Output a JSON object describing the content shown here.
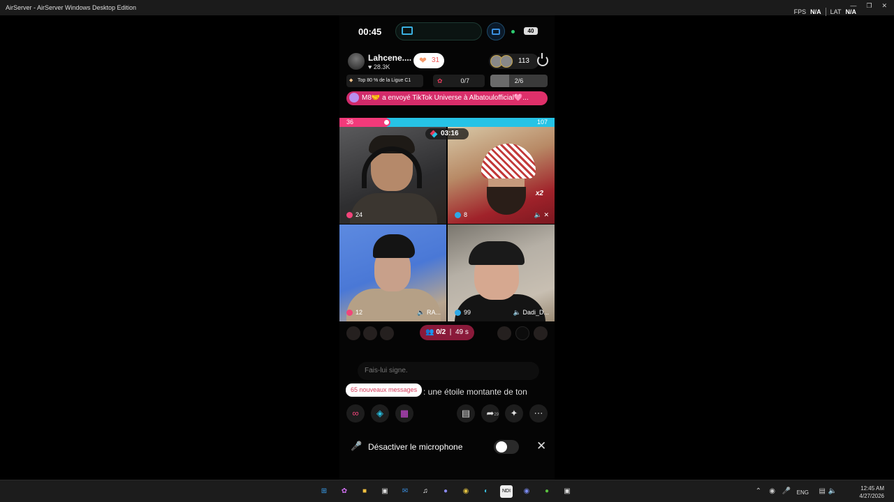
{
  "window": {
    "title": "AirServer - AirServer Windows Desktop Edition",
    "fps_label": "FPS",
    "fps_value": "N/A",
    "lat_label": "LAT",
    "lat_value": "N/A"
  },
  "status_bar": {
    "time": "00:45",
    "battery": "40"
  },
  "host": {
    "name": "Lahcene....",
    "likes": "28.3K",
    "hearts": "31",
    "viewer_count": "113"
  },
  "stats": {
    "league": "Top 80 % de la Ligue C1",
    "roses": "0/7",
    "progress_text": "2/6",
    "progress_fraction": 0.33
  },
  "banner": "M8🤝 a envoyé TikTok Universe à Albatoulofficial🩷...",
  "battle": {
    "left_score": "36",
    "right_score": "107",
    "left_fraction": 0.22,
    "timer": "03:16"
  },
  "participants": [
    {
      "score": "24",
      "team": "pink",
      "name": ""
    },
    {
      "score": "8",
      "team": "blue",
      "name": "",
      "multiplier": "x2"
    },
    {
      "score": "12",
      "team": "pink",
      "name": "RA..."
    },
    {
      "score": "99",
      "team": "blue",
      "name": "Dadi_D..."
    }
  ],
  "invite": {
    "count": "0/2",
    "seconds": "49 s"
  },
  "chat": {
    "placeholder": "Fais-lui signe.",
    "ticker": ": une étoile montante de ton",
    "new_messages": "65 nouveaux messages"
  },
  "toolbar": {
    "share_count": "29"
  },
  "mic": {
    "label": "Désactiver le microphone"
  },
  "taskbar": {
    "lang": "ENG",
    "time": "12:45 AM",
    "date": "4/27/2026"
  }
}
